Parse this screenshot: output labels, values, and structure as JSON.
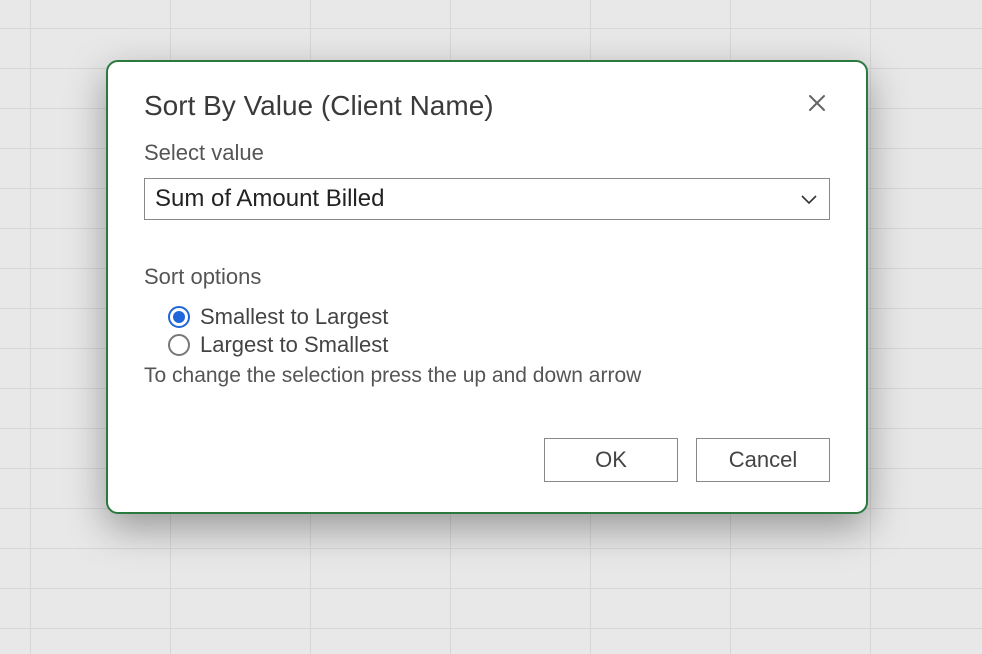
{
  "dialog": {
    "title": "Sort By Value (Client Name)",
    "select_label": "Select value",
    "select_value": "Sum of Amount Billed",
    "options_label": "Sort options",
    "radios": {
      "smallest": "Smallest to Largest",
      "largest": "Largest to Smallest"
    },
    "hint": "To change the selection press the up and down arrow",
    "ok": "OK",
    "cancel": "Cancel"
  }
}
